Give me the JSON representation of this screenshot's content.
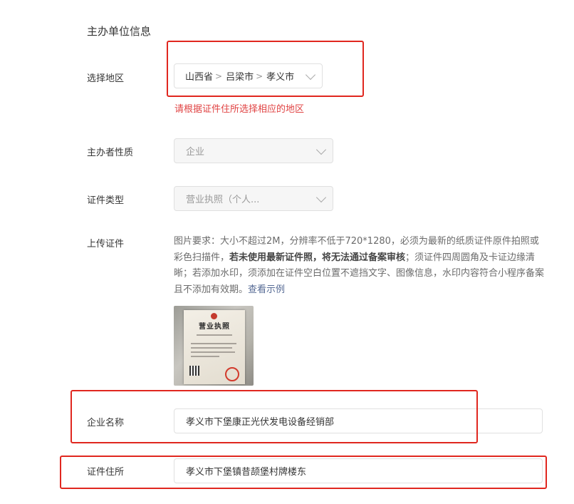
{
  "section": {
    "title": "主办单位信息"
  },
  "region": {
    "label": "选择地区",
    "province": "山西省",
    "city": "吕梁市",
    "county": "孝义市",
    "separator": ">",
    "hint": "请根据证件住所选择相应的地区"
  },
  "nature": {
    "label": "主办者性质",
    "value": "企业"
  },
  "cert_type": {
    "label": "证件类型",
    "value": "营业执照（个人..."
  },
  "upload": {
    "label": "上传证件",
    "desc_part1": "图片要求：大小不超过2M，分辨率不低于720*1280，必须为最新的纸质证件原件拍照或彩色扫描件，",
    "desc_bold": "若未使用最新证件照，将无法通过备案审核",
    "desc_part2": "；须证件四周圆角及卡证边缘清晰；若添加水印，须添加在证件空白位置不遮挡文字、图像信息，水印内容符合小程序备案且不添加有效期。",
    "desc_link": "查看示例",
    "thumb_title": "营业执照"
  },
  "company": {
    "label": "企业名称",
    "value": "孝义市下堡康正光伏发电设备经销部"
  },
  "address": {
    "label": "证件住所",
    "value": "孝义市下堡镇昔颉堡村牌楼东"
  },
  "colors": {
    "annotation_red": "#e0271f",
    "hint_red": "#e04343",
    "link_blue": "#576b95"
  }
}
